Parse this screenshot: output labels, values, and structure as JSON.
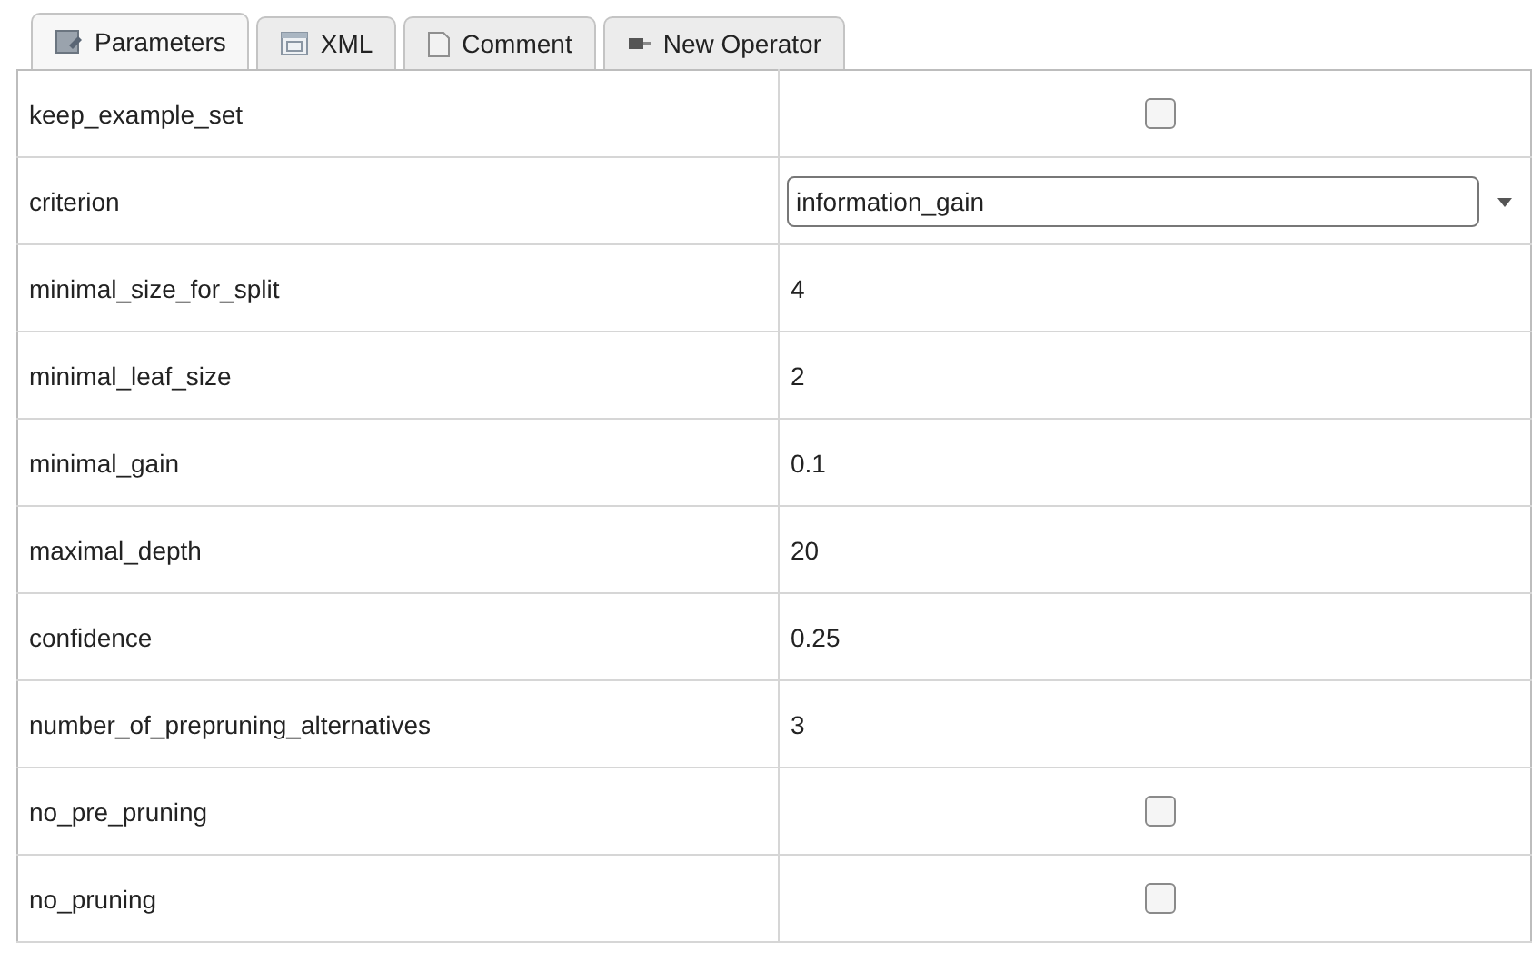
{
  "tabs": [
    {
      "label": "Parameters",
      "selected": true,
      "kind": "params"
    },
    {
      "label": "XML",
      "selected": false,
      "kind": "xml"
    },
    {
      "label": "Comment",
      "selected": false,
      "kind": "doc"
    },
    {
      "label": "New Operator",
      "selected": false,
      "kind": "op"
    }
  ],
  "parameters": [
    {
      "name": "keep_example_set",
      "kind": "checkbox",
      "checked": false
    },
    {
      "name": "criterion",
      "kind": "dropdown",
      "value": "information_gain"
    },
    {
      "name": "minimal_size_for_split",
      "kind": "text",
      "value": "4"
    },
    {
      "name": "minimal_leaf_size",
      "kind": "text",
      "value": "2"
    },
    {
      "name": "minimal_gain",
      "kind": "text",
      "value": "0.1"
    },
    {
      "name": "maximal_depth",
      "kind": "text",
      "value": "20"
    },
    {
      "name": "confidence",
      "kind": "text",
      "value": "0.25"
    },
    {
      "name": "number_of_prepruning_alternatives",
      "kind": "text",
      "value": "3"
    },
    {
      "name": "no_pre_pruning",
      "kind": "checkbox",
      "checked": false
    },
    {
      "name": "no_pruning",
      "kind": "checkbox",
      "checked": false
    }
  ]
}
